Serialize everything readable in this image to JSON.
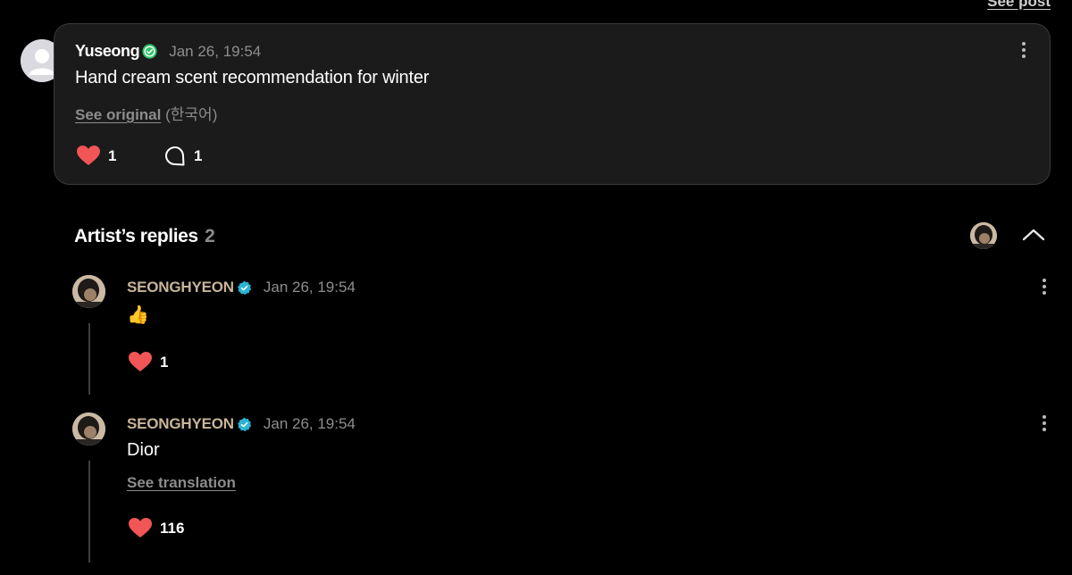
{
  "header": {
    "see_post_label": "See post"
  },
  "post": {
    "username": "Yuseong",
    "timestamp": "Jan 26, 19:54",
    "text": "Hand cream scent recommendation for winter",
    "see_original_label": "See original",
    "language": "(한국어)",
    "like_count": "1",
    "comment_count": "1",
    "colors": {
      "like": "#f25555",
      "verified": "#2fc46a"
    }
  },
  "replies_section": {
    "title": "Artist’s replies",
    "count": "2"
  },
  "replies": [
    {
      "artist": "SEONGHYEON",
      "timestamp": "Jan 26, 19:54",
      "text": "👍",
      "like_count": "1"
    },
    {
      "artist": "SEONGHYEON",
      "timestamp": "Jan 26, 19:54",
      "text": "Dior",
      "see_translation_label": "See translation",
      "like_count": "116"
    }
  ],
  "icons": [
    "heart-icon",
    "comment-icon",
    "more-icon",
    "verified-badge-icon",
    "chevron-up-icon",
    "avatar"
  ]
}
